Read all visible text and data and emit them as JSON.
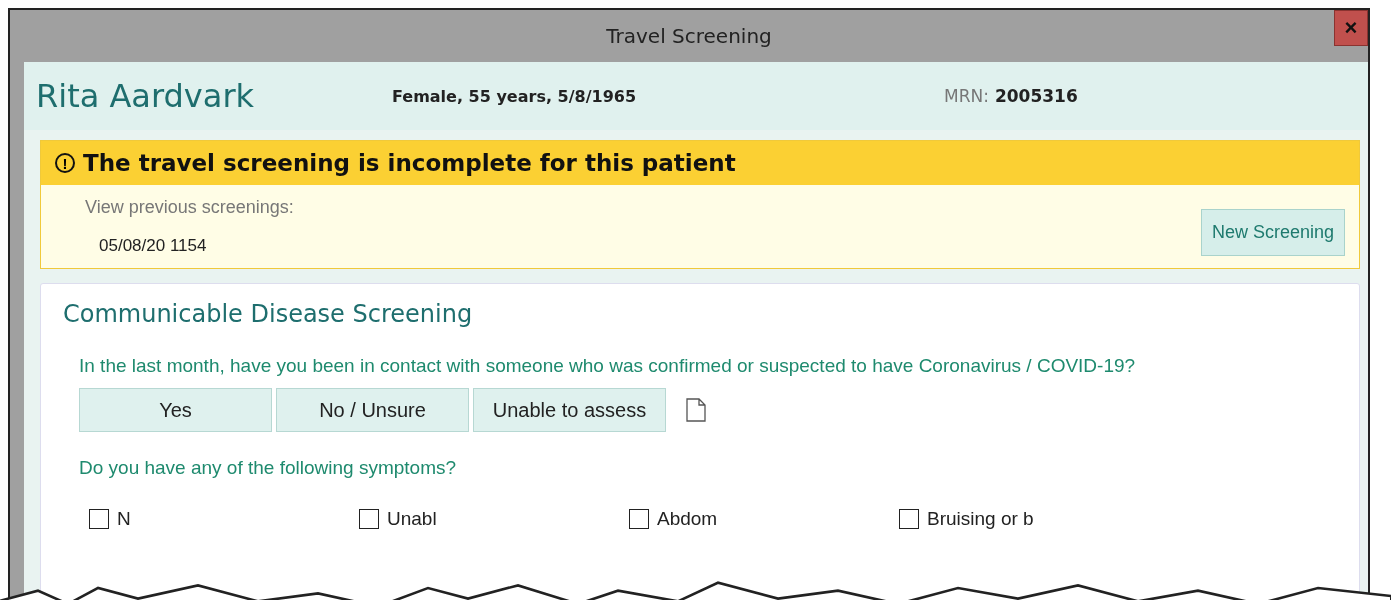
{
  "window": {
    "title": "Travel Screening",
    "close": "×"
  },
  "patient": {
    "name": "Rita Aardvark",
    "demographics": "Female, 55 years, 5/8/1965",
    "mrn_label": "MRN:",
    "mrn": "2005316"
  },
  "alert": {
    "icon": "!",
    "message": "The travel screening is incomplete for this patient",
    "previous_label": "View previous screenings:",
    "previous": [
      "05/08/20 1154"
    ],
    "new_button": "New Screening"
  },
  "section": {
    "title": "Communicable Disease Screening",
    "questions": [
      {
        "text": "In the last month, have you been in contact with someone who was confirmed or suspected to have Coronavirus / COVID-19?",
        "kind": "choice",
        "options": [
          {
            "label": "Yes",
            "selected": false
          },
          {
            "label": "No / Unsure",
            "selected": false
          },
          {
            "label": "Unable to assess",
            "selected": false
          }
        ]
      },
      {
        "text": "Do you have any of the following symptoms?",
        "kind": "checklist",
        "items": [
          {
            "label": "N",
            "checked": false
          },
          {
            "label": "Unabl",
            "checked": false
          },
          {
            "label": "Abdom",
            "checked": false
          },
          {
            "label": "Bruising or b",
            "checked": false
          }
        ]
      }
    ]
  }
}
